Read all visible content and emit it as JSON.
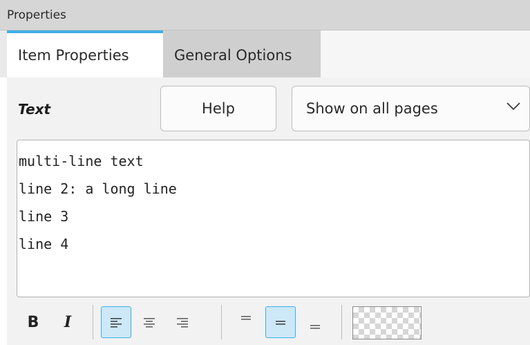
{
  "panel": {
    "title": "Properties"
  },
  "tabs": [
    {
      "label": "Item Properties",
      "active": true
    },
    {
      "label": "General Options",
      "active": false
    }
  ],
  "form": {
    "text_label": "Text",
    "help_label": "Help",
    "visibility_select": {
      "selected": "Show on all pages"
    }
  },
  "text_value": {
    "lines": [
      "multi-line text",
      "line 2: a long line",
      "line 3",
      "line 4"
    ]
  },
  "toolbar": {
    "bold_label": "B",
    "italic_label": "I",
    "align_left_checked": true,
    "valign_center_checked": true
  },
  "colors": {
    "accent": "#3daee9",
    "checked_bg": "#cde8f6"
  },
  "icons": {
    "bold": "bold-icon",
    "italic": "italic-icon",
    "align_left": "align-left-icon",
    "align_center": "align-center-icon",
    "align_right": "align-right-icon",
    "valign_top": "valign-top-icon",
    "valign_center": "valign-center-icon",
    "valign_bottom": "valign-bottom-icon",
    "dropdown": "chevron-down-icon",
    "swatch": "color-swatch"
  }
}
